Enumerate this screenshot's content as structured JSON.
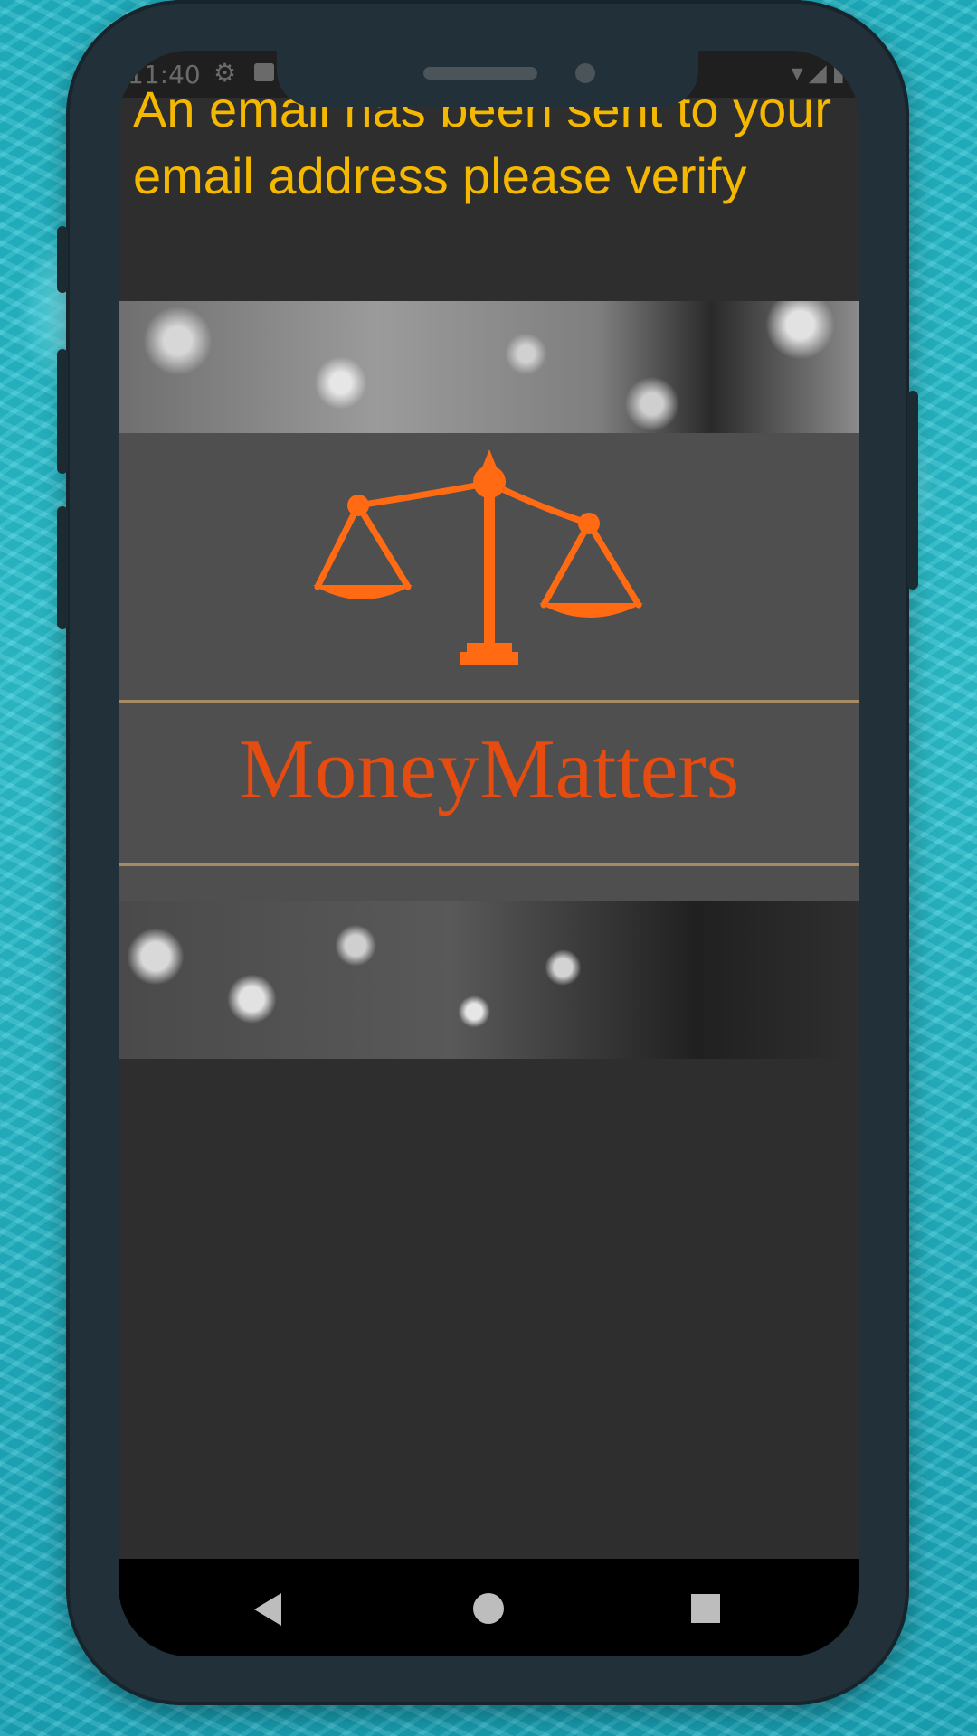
{
  "status_bar": {
    "time": "11:40",
    "right_icons": "▾◢▮"
  },
  "message": "An email has been sent to your email address please verify",
  "banner": {
    "brand": "MoneyMatters"
  },
  "colors": {
    "message_text": "#f5b800",
    "brand_text": "#e64b10",
    "screen_bg": "#2e2e2e",
    "frame": "#223039"
  },
  "icons": {
    "settings": "gear-icon",
    "lock": "lock-icon",
    "wifi": "wifi-icon",
    "signal": "signal-icon",
    "battery": "battery-icon",
    "logo": "balance-scale-icon"
  }
}
